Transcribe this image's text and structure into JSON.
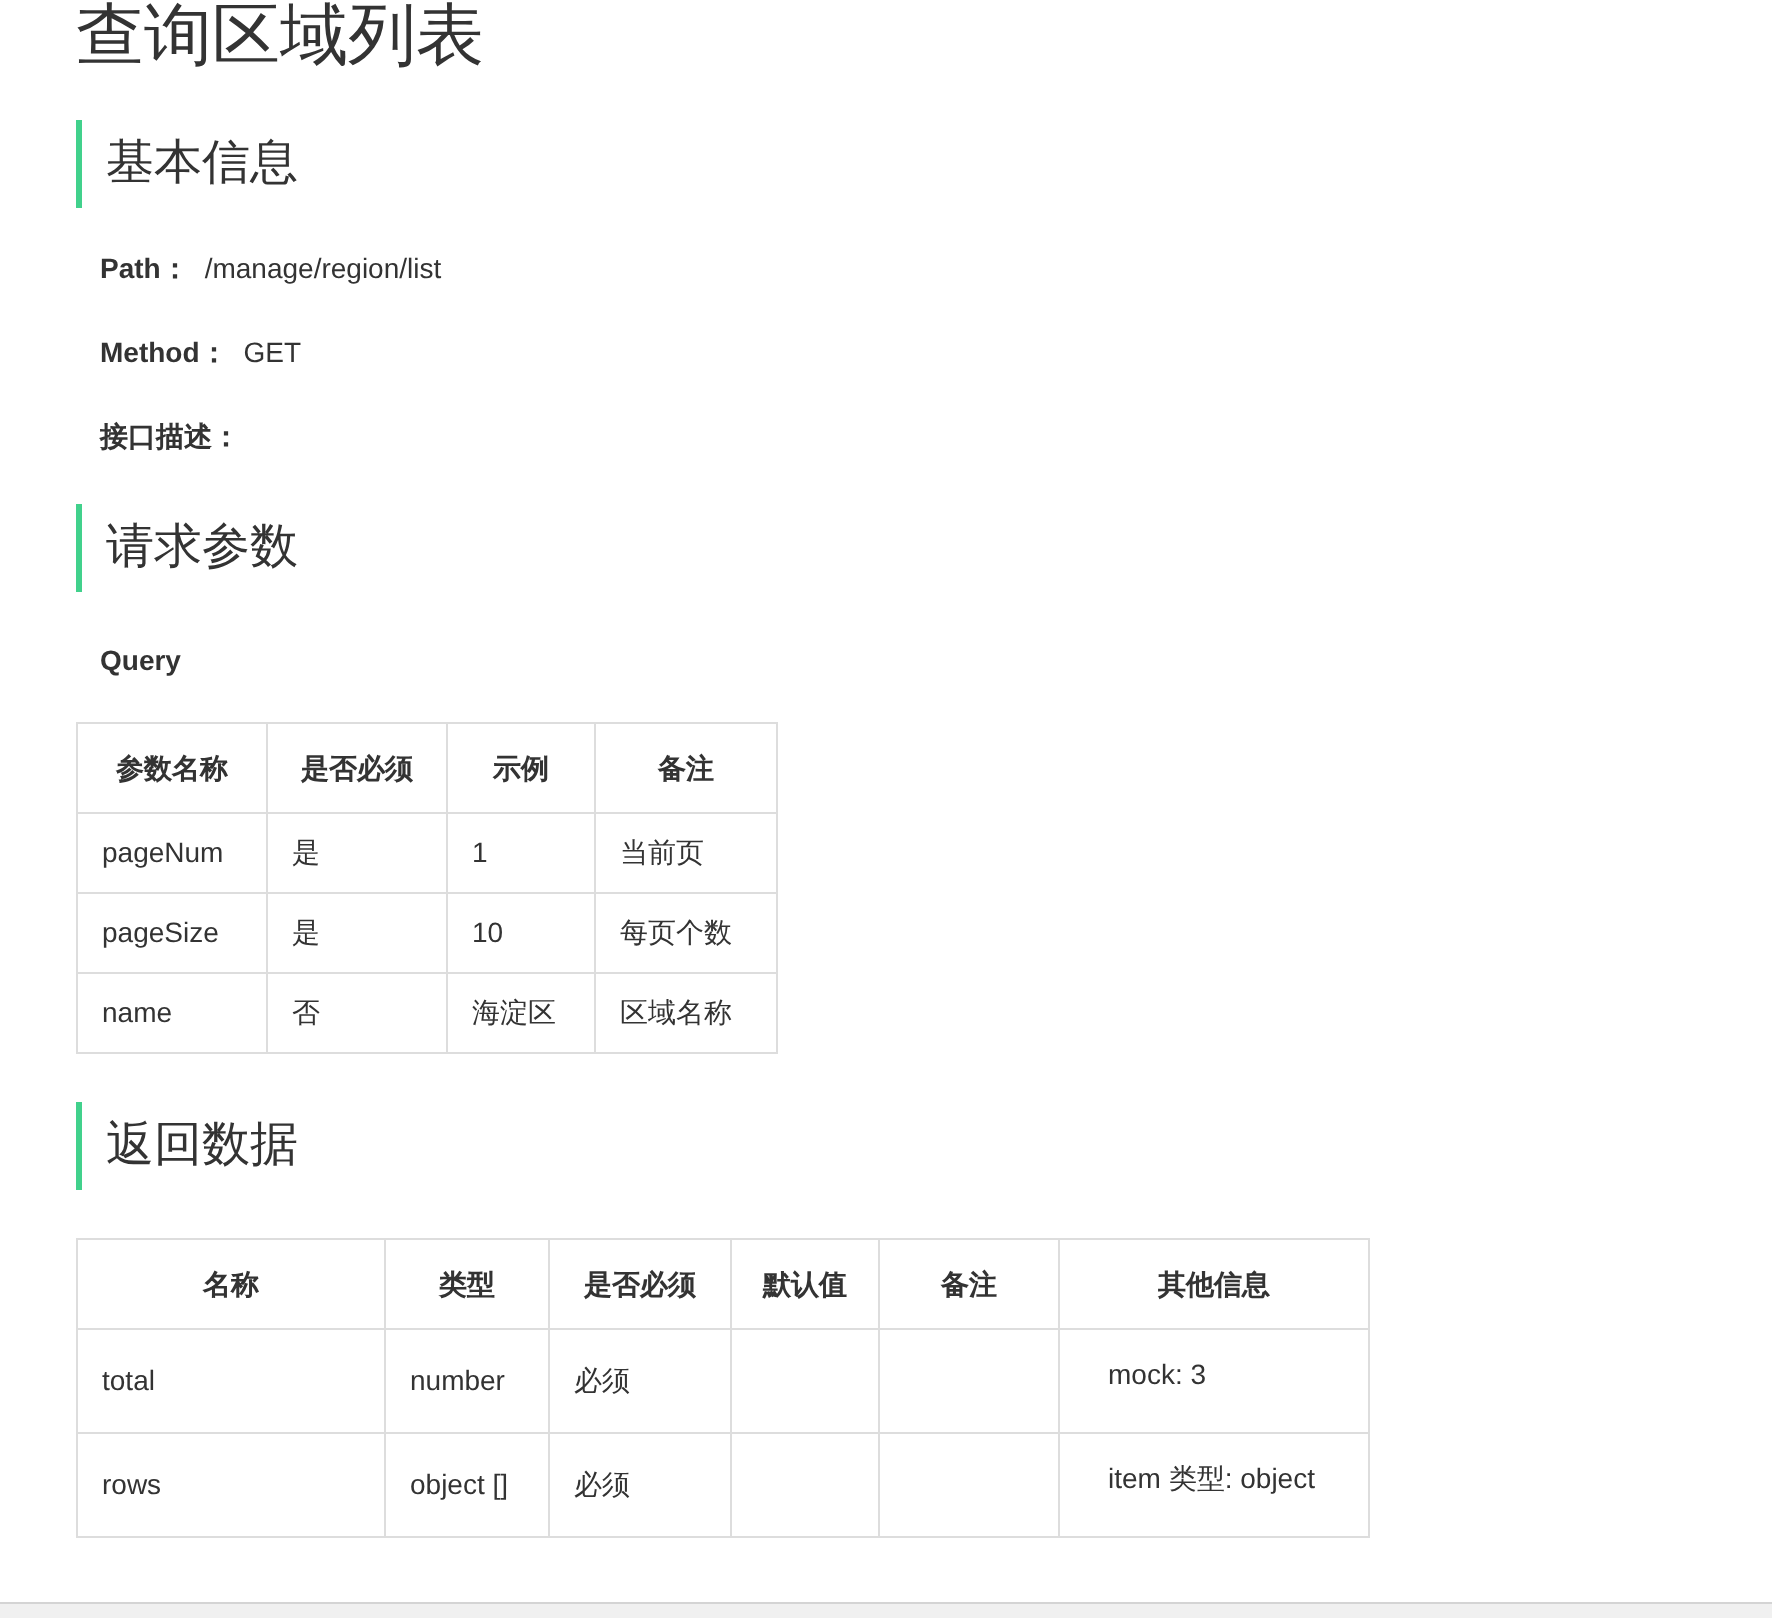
{
  "title": "查询区域列表",
  "basic": {
    "heading": "基本信息",
    "fields": [
      {
        "label": "Path：",
        "value": "/manage/region/list"
      },
      {
        "label": "Method：",
        "value": "GET"
      },
      {
        "label": "接口描述："
      }
    ]
  },
  "request": {
    "heading": "请求参数",
    "subheading": "Query",
    "columns": [
      "参数名称",
      "是否必须",
      "示例",
      "备注"
    ],
    "rows": [
      [
        "pageNum",
        "是",
        "1",
        "当前页"
      ],
      [
        "pageSize",
        "是",
        "10",
        "每页个数"
      ],
      [
        "name",
        "否",
        "海淀区",
        "区域名称"
      ]
    ]
  },
  "response": {
    "heading": "返回数据",
    "columns": [
      "名称",
      "类型",
      "是否必须",
      "默认值",
      "备注",
      "其他信息"
    ],
    "rows": [
      [
        "total",
        "number",
        "必须",
        null,
        null,
        "mock: 3"
      ],
      [
        "rows",
        "object []",
        "必须",
        null,
        null,
        "item 类型: object"
      ]
    ]
  }
}
